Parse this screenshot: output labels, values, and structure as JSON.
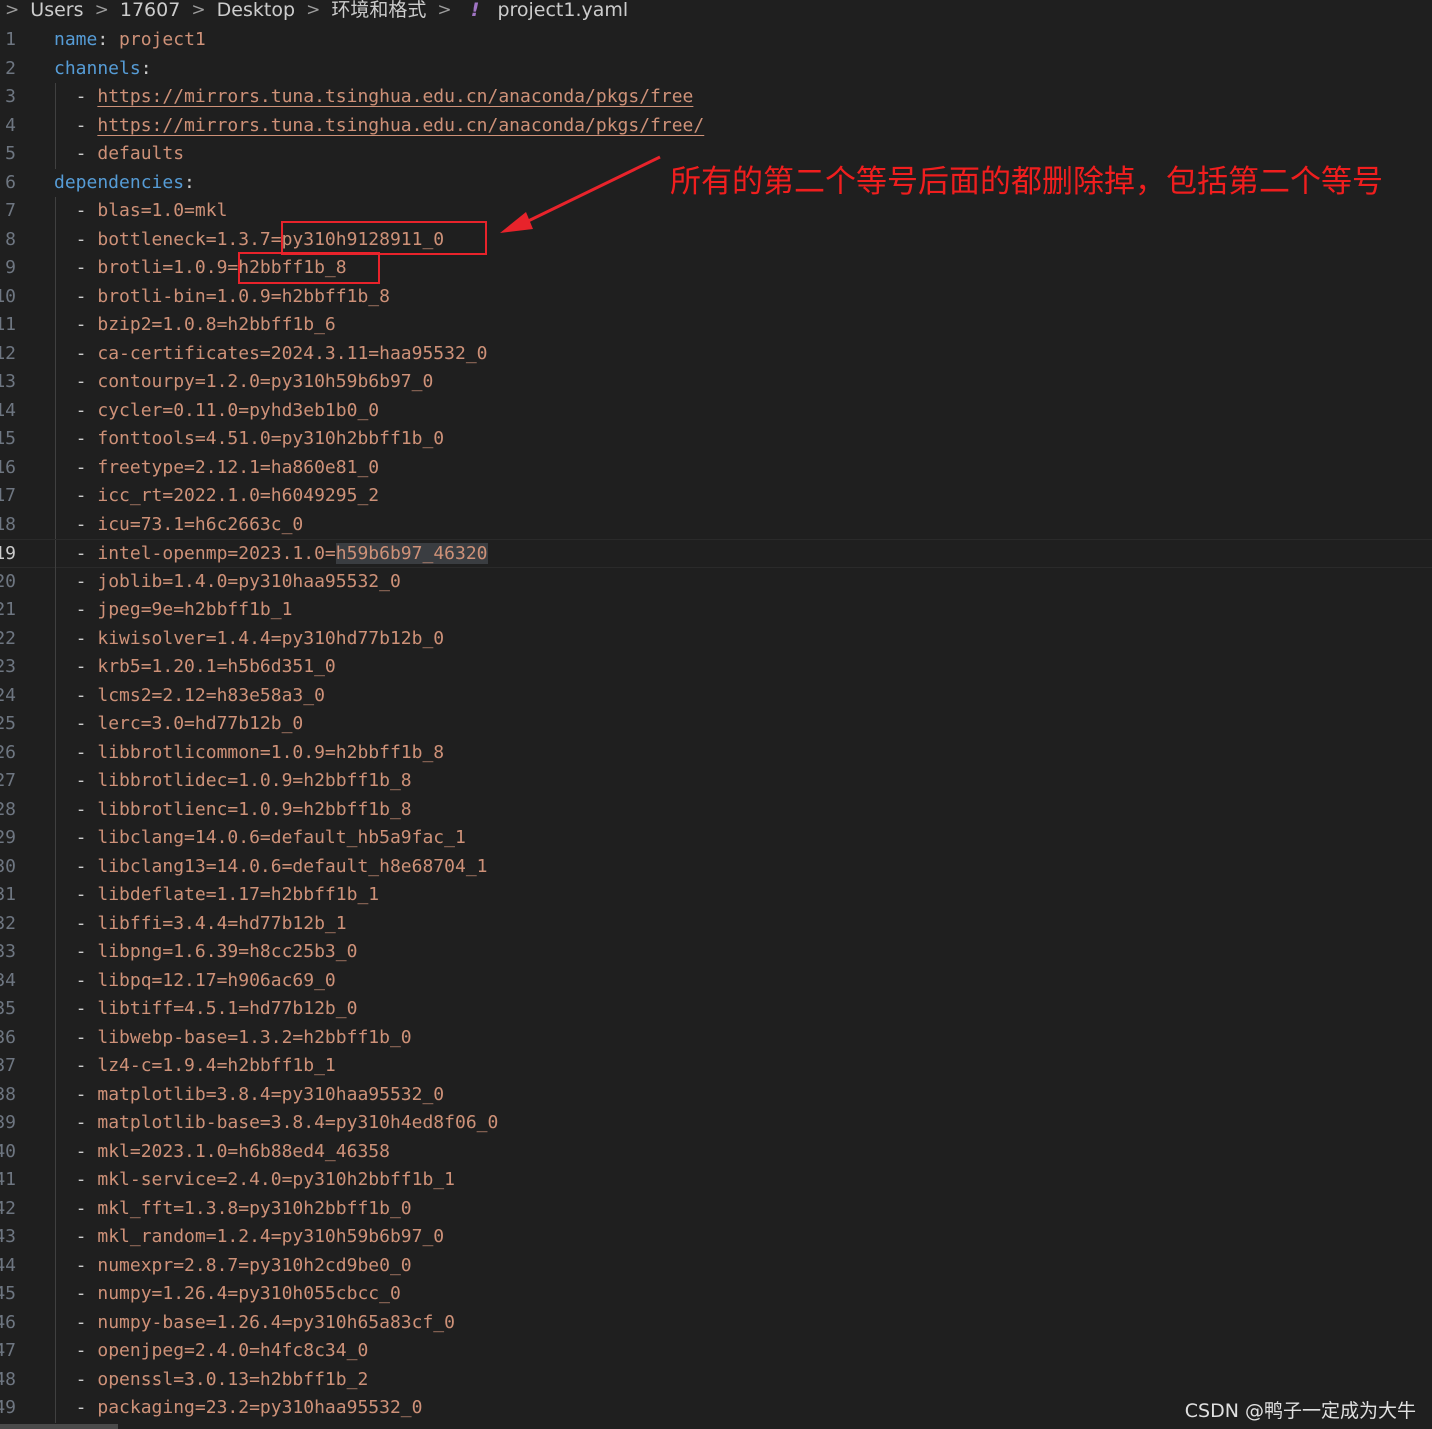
{
  "breadcrumb": {
    "items": [
      "Users",
      "17607",
      "Desktop",
      "环境和格式"
    ],
    "file_icon": "!",
    "file_name": "project1.yaml"
  },
  "editor": {
    "current_line": 19,
    "lines": [
      {
        "n": "1",
        "kind": "kv",
        "key": "name",
        "value": "project1"
      },
      {
        "n": "2",
        "kind": "key",
        "key": "channels"
      },
      {
        "n": "3",
        "kind": "url",
        "value": "https://mirrors.tuna.tsinghua.edu.cn/anaconda/pkgs/free"
      },
      {
        "n": "4",
        "kind": "url",
        "value": "https://mirrors.tuna.tsinghua.edu.cn/anaconda/pkgs/free/"
      },
      {
        "n": "5",
        "kind": "item",
        "value": "defaults"
      },
      {
        "n": "6",
        "kind": "key",
        "key": "dependencies"
      },
      {
        "n": "7",
        "kind": "item",
        "value": "blas=1.0=mkl"
      },
      {
        "n": "8",
        "kind": "item",
        "value": "bottleneck=1.3.7=py310h9128911_0"
      },
      {
        "n": "9",
        "kind": "item",
        "value": "brotli=1.0.9=h2bbff1b_8"
      },
      {
        "n": "10",
        "kind": "item",
        "value": "brotli-bin=1.0.9=h2bbff1b_8"
      },
      {
        "n": "11",
        "kind": "item",
        "value": "bzip2=1.0.8=h2bbff1b_6"
      },
      {
        "n": "12",
        "kind": "item",
        "value": "ca-certificates=2024.3.11=haa95532_0"
      },
      {
        "n": "13",
        "kind": "item",
        "value": "contourpy=1.2.0=py310h59b6b97_0"
      },
      {
        "n": "14",
        "kind": "item",
        "value": "cycler=0.11.0=pyhd3eb1b0_0"
      },
      {
        "n": "15",
        "kind": "item",
        "value": "fonttools=4.51.0=py310h2bbff1b_0"
      },
      {
        "n": "16",
        "kind": "item",
        "value": "freetype=2.12.1=ha860e81_0"
      },
      {
        "n": "17",
        "kind": "item",
        "value": "icc_rt=2022.1.0=h6049295_2"
      },
      {
        "n": "18",
        "kind": "item",
        "value": "icu=73.1=h6c2663c_0"
      },
      {
        "n": "19",
        "kind": "item",
        "value": "intel-openmp=2023.1.0=",
        "selected": "h59b6b97_46320"
      },
      {
        "n": "20",
        "kind": "item",
        "value": "joblib=1.4.0=py310haa95532_0"
      },
      {
        "n": "21",
        "kind": "item",
        "value": "jpeg=9e=h2bbff1b_1"
      },
      {
        "n": "22",
        "kind": "item",
        "value": "kiwisolver=1.4.4=py310hd77b12b_0"
      },
      {
        "n": "23",
        "kind": "item",
        "value": "krb5=1.20.1=h5b6d351_0"
      },
      {
        "n": "24",
        "kind": "item",
        "value": "lcms2=2.12=h83e58a3_0"
      },
      {
        "n": "25",
        "kind": "item",
        "value": "lerc=3.0=hd77b12b_0"
      },
      {
        "n": "26",
        "kind": "item",
        "value": "libbrotlicommon=1.0.9=h2bbff1b_8"
      },
      {
        "n": "27",
        "kind": "item",
        "value": "libbrotlidec=1.0.9=h2bbff1b_8"
      },
      {
        "n": "28",
        "kind": "item",
        "value": "libbrotlienc=1.0.9=h2bbff1b_8"
      },
      {
        "n": "29",
        "kind": "item",
        "value": "libclang=14.0.6=default_hb5a9fac_1"
      },
      {
        "n": "30",
        "kind": "item",
        "value": "libclang13=14.0.6=default_h8e68704_1"
      },
      {
        "n": "31",
        "kind": "item",
        "value": "libdeflate=1.17=h2bbff1b_1"
      },
      {
        "n": "32",
        "kind": "item",
        "value": "libffi=3.4.4=hd77b12b_1"
      },
      {
        "n": "33",
        "kind": "item",
        "value": "libpng=1.6.39=h8cc25b3_0"
      },
      {
        "n": "34",
        "kind": "item",
        "value": "libpq=12.17=h906ac69_0"
      },
      {
        "n": "35",
        "kind": "item",
        "value": "libtiff=4.5.1=hd77b12b_0"
      },
      {
        "n": "36",
        "kind": "item",
        "value": "libwebp-base=1.3.2=h2bbff1b_0"
      },
      {
        "n": "37",
        "kind": "item",
        "value": "lz4-c=1.9.4=h2bbff1b_1"
      },
      {
        "n": "38",
        "kind": "item",
        "value": "matplotlib=3.8.4=py310haa95532_0"
      },
      {
        "n": "39",
        "kind": "item",
        "value": "matplotlib-base=3.8.4=py310h4ed8f06_0"
      },
      {
        "n": "40",
        "kind": "item",
        "value": "mkl=2023.1.0=h6b88ed4_46358"
      },
      {
        "n": "41",
        "kind": "item",
        "value": "mkl-service=2.4.0=py310h2bbff1b_1"
      },
      {
        "n": "42",
        "kind": "item",
        "value": "mkl_fft=1.3.8=py310h2bbff1b_0"
      },
      {
        "n": "43",
        "kind": "item",
        "value": "mkl_random=1.2.4=py310h59b6b97_0"
      },
      {
        "n": "44",
        "kind": "item",
        "value": "numexpr=2.8.7=py310h2cd9be0_0"
      },
      {
        "n": "45",
        "kind": "item",
        "value": "numpy=1.26.4=py310h055cbcc_0"
      },
      {
        "n": "46",
        "kind": "item",
        "value": "numpy-base=1.26.4=py310h65a83cf_0"
      },
      {
        "n": "47",
        "kind": "item",
        "value": "openjpeg=2.4.0=h4fc8c34_0"
      },
      {
        "n": "48",
        "kind": "item",
        "value": "openssl=3.0.13=h2bbff1b_2"
      },
      {
        "n": "49",
        "kind": "item",
        "value": "packaging=23.2=py310haa95532_0"
      }
    ]
  },
  "annotation": {
    "text": "所有的第二个等号后面的都删除掉，包括第二个等号",
    "color": "#f01e1e"
  },
  "watermark": "CSDN @鸭子一定成为大牛",
  "colors": {
    "background": "#1f1f1f",
    "key": "#569cd6",
    "value": "#ce9178",
    "annotation_red": "#e8232b"
  }
}
